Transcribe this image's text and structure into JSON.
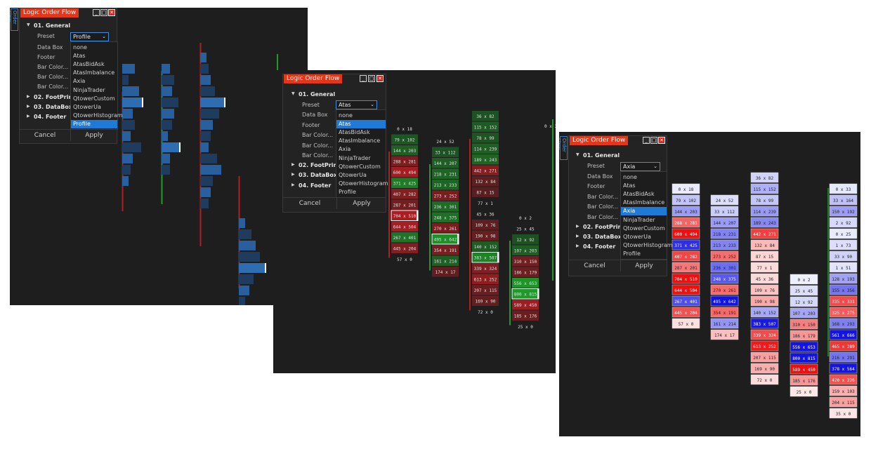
{
  "window_title": "Logic Order Flow",
  "side_tab": "Order Flow",
  "window_buttons": {
    "minimize": "_",
    "maximize": "□",
    "close": "✕"
  },
  "settings": {
    "section_general": "01. General",
    "preset_label": "Preset",
    "data_box_label": "Data Box",
    "footer_label": "Footer",
    "bar_color_label": "Bar Color...",
    "section_footprint": "02. FootPrint",
    "section_databox": "03. DataBox",
    "section_footer": "04. Footer",
    "cancel": "Cancel",
    "apply": "Apply"
  },
  "preset_options": [
    "none",
    "Atas",
    "AtasBidAsk",
    "AtasImbalance",
    "Axia",
    "NinjaTrader",
    "QtowerCustom",
    "QtowerUa",
    "QtowerHistogram",
    "Profile"
  ],
  "panels": [
    {
      "selected_preset": "Profile",
      "selected_index": 9
    },
    {
      "selected_preset": "Atas",
      "selected_index": 1
    },
    {
      "selected_preset": "Axia",
      "selected_index": 4
    }
  ],
  "footprint_columns": [
    [
      "0 x 18",
      "79 x 102",
      "144 x 203",
      "288 x 281",
      "600 x 494",
      "371 x 425",
      "407 x 282",
      "287 x 201",
      "704 x 510",
      "644 x 504",
      "267 x 401",
      "445 x 204",
      "57 x 0"
    ],
    [
      "24 x 52",
      "33 x 112",
      "144 x 207",
      "218 x 231",
      "213 x 233",
      "273 x 252",
      "236 x 301",
      "248 x 375",
      "270 x 261",
      "495 x 642",
      "354 x 191",
      "161 x 214",
      "174 x 17"
    ],
    [
      "36 x 82",
      "115 x 152",
      "78 x 99",
      "114 x 239",
      "189 x 243",
      "442 x 271",
      "132 x 84",
      "87 x 15",
      "77 x 1",
      "45 x 36",
      "109 x 76",
      "190 x 98",
      "140 x 152",
      "383 x 507",
      "339 x 324",
      "613 x 252",
      "207 x 115",
      "169 x 90",
      "72 x 0"
    ],
    [
      "0 x 2",
      "25 x 45",
      "12 x 92",
      "107 x 203",
      "310 x 150",
      "186 x 179",
      "556 x 653",
      "800 x 815",
      "589 x 450",
      "185 x 176",
      "25 x 0"
    ],
    [
      "0 x 33",
      "33 x 164",
      "150 x 192",
      "2 x 92",
      "0 x 25",
      "1 x 73",
      "33 x 90",
      "1 x 51",
      "128 x 193",
      "155 x 356",
      "335 x 331",
      "325 x 275",
      "168 x 293",
      "561 x 666",
      "465 x 289",
      "216 x 291",
      "378 x 564",
      "420 x 226",
      "159 x 103",
      "204 x 115",
      "35 x 0"
    ]
  ],
  "colors": {
    "panel_bg": "#1e1e1f",
    "title_red": "#e2371a",
    "select_blue": "#1e7ad6",
    "profile_blue": "#2a5f9e",
    "profile_blue_dark": "#1f3b5e",
    "bull_green": "#1f9a2a",
    "bear_red": "#b01e22"
  }
}
